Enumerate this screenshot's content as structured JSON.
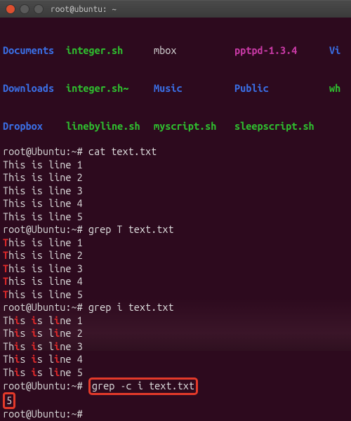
{
  "title_bar": {
    "user_host": "root@ubuntu: ~"
  },
  "listing": {
    "r1": {
      "c1": "Documents",
      "c2": "integer.sh",
      "c3": "mbox",
      "c4": "pptpd-1.3.4",
      "c5": "Vi"
    },
    "r2": {
      "c1": "Downloads",
      "c2": "integer.sh~",
      "c3": "Music",
      "c4": "Public",
      "c5": "wh"
    },
    "r3": {
      "c1": "Dropbox",
      "c2": "linebyline.sh",
      "c3": "myscript.sh",
      "c4": "sleepscript.sh"
    }
  },
  "prompt": {
    "userhost": "root@Ubuntu",
    "sep1": ":",
    "path": "~",
    "sep2": "#"
  },
  "commands": {
    "cat": "cat text.txt",
    "grepT": "grep T text.txt",
    "grepi": "grep i text.txt",
    "grepci": "grep -c i text.txt"
  },
  "cat_output": [
    "This is line 1",
    "This is line 2",
    "This is line 3",
    "This is line 4",
    "This is line 5"
  ],
  "grepT": {
    "lines": [
      {
        "hl": "T",
        "rest": "his is line 1"
      },
      {
        "hl": "T",
        "rest": "his is line 2"
      },
      {
        "hl": "T",
        "rest": "his is line 3"
      },
      {
        "hl": "T",
        "rest": "his is line 4"
      },
      {
        "hl": "T",
        "rest": "his is line 5"
      }
    ]
  },
  "grepi": {
    "lines": [
      {
        "p1": "Th",
        "h1": "i",
        "p2": "s ",
        "h2": "i",
        "p3": "s l",
        "h3": "i",
        "p4": "ne 1"
      },
      {
        "p1": "Th",
        "h1": "i",
        "p2": "s ",
        "h2": "i",
        "p3": "s l",
        "h3": "i",
        "p4": "ne 2"
      },
      {
        "p1": "Th",
        "h1": "i",
        "p2": "s ",
        "h2": "i",
        "p3": "s l",
        "h3": "i",
        "p4": "ne 3"
      },
      {
        "p1": "Th",
        "h1": "i",
        "p2": "s ",
        "h2": "i",
        "p3": "s l",
        "h3": "i",
        "p4": "ne 4"
      },
      {
        "p1": "Th",
        "h1": "i",
        "p2": "s ",
        "h2": "i",
        "p3": "s l",
        "h3": "i",
        "p4": "ne 5"
      }
    ]
  },
  "grepci_result": "5"
}
